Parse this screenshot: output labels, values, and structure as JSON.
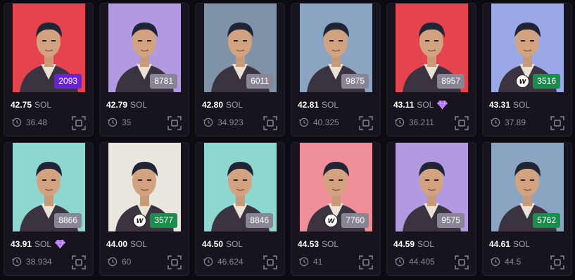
{
  "currency": "SOL",
  "items": [
    {
      "number": "2093",
      "badge_color": "#6a22d9",
      "wallet_badge": false,
      "price": "42.75",
      "gem": false,
      "last_sale": "36.48",
      "bg": "#e5444f"
    },
    {
      "number": "8781",
      "badge_color": "#8a8595",
      "wallet_badge": false,
      "price": "42.79",
      "gem": false,
      "last_sale": "35",
      "bg": "#b29ae0"
    },
    {
      "number": "6011",
      "badge_color": "#8a8595",
      "wallet_badge": false,
      "price": "42.80",
      "gem": false,
      "last_sale": "34.923",
      "bg": "#7e93a8"
    },
    {
      "number": "9875",
      "badge_color": "#8a8595",
      "wallet_badge": false,
      "price": "42.81",
      "gem": false,
      "last_sale": "40.325",
      "bg": "#8aa4c2"
    },
    {
      "number": "8957",
      "badge_color": "#8a8595",
      "wallet_badge": false,
      "price": "43.11",
      "gem": true,
      "last_sale": "36.211",
      "bg": "#e5444f"
    },
    {
      "number": "3516",
      "badge_color": "#1a8f4c",
      "wallet_badge": true,
      "price": "43.31",
      "gem": false,
      "last_sale": "37.89",
      "bg": "#9aa8e8"
    },
    {
      "number": "8866",
      "badge_color": "#8a8595",
      "wallet_badge": false,
      "price": "43.91",
      "gem": true,
      "last_sale": "38.934",
      "bg": "#8ed6d0"
    },
    {
      "number": "3577",
      "badge_color": "#1a8f4c",
      "wallet_badge": true,
      "price": "44.00",
      "gem": false,
      "last_sale": "60",
      "bg": "#eae7df"
    },
    {
      "number": "8846",
      "badge_color": "#8a8595",
      "wallet_badge": false,
      "price": "44.50",
      "gem": false,
      "last_sale": "46.624",
      "bg": "#8ed6d0"
    },
    {
      "number": "7760",
      "badge_color": "#8a8595",
      "wallet_badge": true,
      "price": "44.53",
      "gem": false,
      "last_sale": "41",
      "bg": "#ef8f99"
    },
    {
      "number": "9575",
      "badge_color": "#8a8595",
      "wallet_badge": false,
      "price": "44.59",
      "gem": false,
      "last_sale": "44.405",
      "bg": "#b29ae0"
    },
    {
      "number": "5762",
      "badge_color": "#1a8f4c",
      "wallet_badge": false,
      "price": "44.61",
      "gem": false,
      "last_sale": "44.5",
      "bg": "#8aa4c2"
    }
  ],
  "icons": {
    "wallet_badge_glyph": "w",
    "last_sale": "last-sale-icon",
    "gem": "diamond-icon",
    "scan": "scan-icon"
  }
}
